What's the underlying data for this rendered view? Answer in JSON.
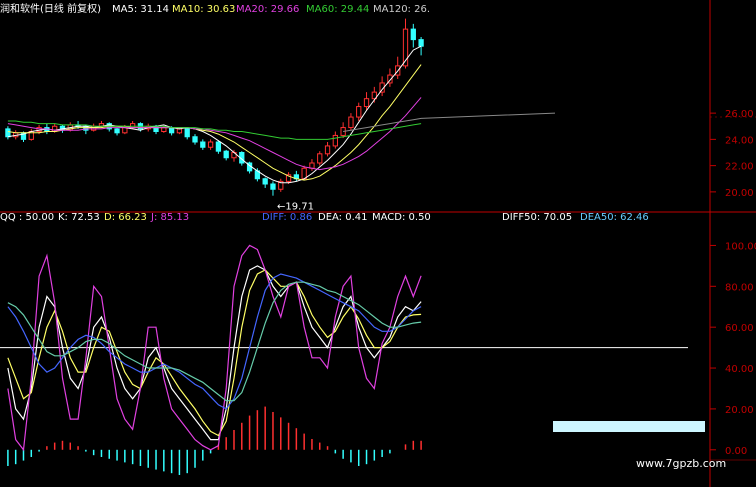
{
  "header": {
    "title": "润和软件(日线 前复权)",
    "ma5": "MA5: 31.14",
    "ma10": "MA10: 30.63",
    "ma20": "MA20: 29.66",
    "ma60": "MA60: 29.44",
    "ma120": "MA120: 26."
  },
  "indicator_header": {
    "qq": "QQ : 50.00",
    "k": "K: 72.53",
    "d": "D: 66.23",
    "j": "J: 85.13",
    "diff": "DIFF: 0.86",
    "dea": "DEA: 0.41",
    "macd": "MACD: 0.50",
    "diff50": "DIFF50: 70.05",
    "dea50": "DEA50: 62.46"
  },
  "annotations": {
    "low_marker": "←19.71",
    "watermark": "www.7gpzb.com"
  },
  "colors": {
    "up": "#ff3030",
    "down": "#33ffff",
    "ma5": "#ffffff",
    "ma10": "#ffff66",
    "ma20": "#e040e0",
    "ma60": "#33cc33",
    "ma120": "#888888",
    "k": "#ffffff",
    "d": "#ffff66",
    "j": "#e040e0",
    "axis": "#c00000"
  },
  "chart_data": [
    {
      "type": "candlestick",
      "title": "润和软件(日线 前复权)",
      "ylim": [
        19,
        27
      ],
      "y_ticks": [
        "26.00",
        "24.00",
        "22.00",
        "20.00"
      ],
      "low_label": "19.71",
      "series": [
        {
          "name": "MA5",
          "values": [
            24.2,
            24.3,
            24.4,
            24.6,
            24.7,
            24.8,
            24.7,
            24.8,
            24.9,
            25.0,
            25.0,
            24.9,
            25.0,
            25.1,
            25.0,
            24.9,
            24.8,
            24.7,
            24.9,
            25.0,
            25.1,
            24.9,
            24.8,
            24.9,
            24.8,
            24.6,
            24.3,
            23.9,
            23.5,
            23.0,
            22.5,
            22.0,
            21.6,
            21.2,
            20.9,
            20.7,
            20.7,
            20.8,
            21.0,
            21.4,
            21.9,
            22.4,
            23.0,
            23.6,
            24.4,
            25.3,
            26.2,
            27.0,
            27.8,
            28.5,
            29.2,
            30.0,
            30.8,
            31.1
          ]
        },
        {
          "name": "MA10",
          "values": [
            24.6,
            24.5,
            24.5,
            24.5,
            24.5,
            24.6,
            24.6,
            24.7,
            24.8,
            24.9,
            24.9,
            24.9,
            24.9,
            25.0,
            25.0,
            25.0,
            24.9,
            24.9,
            24.9,
            24.9,
            24.9,
            24.9,
            24.9,
            24.9,
            24.8,
            24.7,
            24.6,
            24.4,
            24.1,
            23.8,
            23.4,
            23.0,
            22.6,
            22.2,
            21.8,
            21.5,
            21.2,
            21.0,
            20.9,
            21.0,
            21.2,
            21.6,
            22.0,
            22.5,
            23.0,
            23.6,
            24.3,
            25.0,
            25.8,
            26.5,
            27.3,
            28.1,
            28.9,
            29.7
          ]
        },
        {
          "name": "MA20",
          "values": [
            25.2,
            25.1,
            25.0,
            24.9,
            24.8,
            24.8,
            24.7,
            24.7,
            24.7,
            24.7,
            24.8,
            24.8,
            24.8,
            24.9,
            24.9,
            24.9,
            24.9,
            24.9,
            24.9,
            24.9,
            24.9,
            24.9,
            24.9,
            24.9,
            24.8,
            24.8,
            24.7,
            24.6,
            24.5,
            24.3,
            24.1,
            23.9,
            23.6,
            23.3,
            23.0,
            22.7,
            22.4,
            22.1,
            21.9,
            21.8,
            21.7,
            21.8,
            21.9,
            22.1,
            22.4,
            22.7,
            23.1,
            23.6,
            24.1,
            24.6,
            25.2,
            25.8,
            26.5,
            27.2
          ]
        },
        {
          "name": "MA60",
          "values": [
            25.4,
            25.4,
            25.3,
            25.3,
            25.2,
            25.2,
            25.2,
            25.1,
            25.1,
            25.1,
            25.1,
            25.0,
            25.0,
            25.0,
            25.0,
            25.0,
            25.0,
            25.0,
            25.0,
            25.0,
            25.0,
            24.9,
            24.9,
            24.9,
            24.9,
            24.8,
            24.8,
            24.7,
            24.7,
            24.6,
            24.6,
            24.5,
            24.4,
            24.3,
            24.2,
            24.1,
            24.1,
            24.0,
            24.0,
            24.0,
            24.0,
            24.0,
            24.1,
            24.2,
            24.3,
            24.4,
            24.5,
            24.6,
            24.7,
            24.8,
            24.9,
            25.0,
            25.1,
            25.2
          ]
        },
        {
          "name": "MA120",
          "values": [
            null,
            null,
            null,
            null,
            null,
            null,
            null,
            null,
            null,
            null,
            null,
            null,
            null,
            null,
            null,
            null,
            null,
            null,
            null,
            null,
            null,
            null,
            null,
            null,
            null,
            null,
            null,
            null,
            null,
            null,
            null,
            null,
            null,
            null,
            null,
            null,
            null,
            null,
            null,
            null,
            null,
            null,
            null,
            24.6,
            24.7,
            24.8,
            24.9,
            25.0,
            25.1,
            25.2,
            25.3,
            25.4,
            25.5,
            25.6
          ]
        }
      ],
      "candles": [
        [
          24.8,
          24.2,
          25.0,
          24.0
        ],
        [
          24.2,
          24.5,
          24.7,
          24.0
        ],
        [
          24.5,
          24.0,
          24.6,
          23.8
        ],
        [
          24.0,
          24.6,
          24.8,
          23.9
        ],
        [
          24.6,
          24.9,
          25.1,
          24.4
        ],
        [
          24.9,
          24.6,
          25.2,
          24.4
        ],
        [
          24.6,
          25.0,
          25.2,
          24.5
        ],
        [
          25.0,
          24.7,
          25.1,
          24.5
        ],
        [
          24.7,
          25.1,
          25.3,
          24.6
        ],
        [
          25.1,
          25.0,
          25.4,
          24.8
        ],
        [
          25.0,
          24.7,
          25.1,
          24.4
        ],
        [
          24.7,
          25.0,
          25.2,
          24.6
        ],
        [
          25.0,
          25.2,
          25.4,
          24.9
        ],
        [
          25.2,
          24.8,
          25.3,
          24.6
        ],
        [
          24.8,
          24.5,
          24.9,
          24.3
        ],
        [
          24.5,
          24.9,
          25.1,
          24.4
        ],
        [
          24.9,
          25.2,
          25.4,
          24.8
        ],
        [
          25.2,
          24.8,
          25.3,
          24.6
        ],
        [
          24.8,
          25.0,
          25.2,
          24.6
        ],
        [
          25.0,
          24.6,
          25.1,
          24.4
        ],
        [
          24.6,
          24.9,
          25.0,
          24.5
        ],
        [
          24.9,
          24.5,
          25.0,
          24.3
        ],
        [
          24.5,
          24.8,
          24.9,
          24.4
        ],
        [
          24.8,
          24.2,
          24.9,
          24.0
        ],
        [
          24.2,
          23.8,
          24.4,
          23.6
        ],
        [
          23.8,
          23.4,
          24.0,
          23.2
        ],
        [
          23.4,
          23.8,
          24.0,
          23.2
        ],
        [
          23.8,
          23.1,
          23.9,
          22.9
        ],
        [
          23.1,
          22.6,
          23.2,
          22.4
        ],
        [
          22.6,
          23.0,
          23.2,
          22.3
        ],
        [
          23.0,
          22.2,
          23.1,
          22.0
        ],
        [
          22.2,
          21.6,
          22.3,
          21.4
        ],
        [
          21.6,
          21.0,
          21.8,
          20.8
        ],
        [
          21.0,
          20.6,
          21.1,
          20.3
        ],
        [
          20.6,
          20.2,
          20.8,
          19.71
        ],
        [
          20.2,
          20.8,
          21.0,
          20.0
        ],
        [
          20.8,
          21.3,
          21.5,
          20.6
        ],
        [
          21.3,
          21.0,
          21.6,
          20.8
        ],
        [
          21.0,
          21.8,
          22.0,
          20.9
        ],
        [
          21.8,
          22.2,
          22.5,
          21.6
        ],
        [
          22.2,
          22.9,
          23.1,
          22.0
        ],
        [
          22.9,
          23.5,
          23.8,
          22.7
        ],
        [
          23.5,
          24.3,
          24.6,
          23.3
        ],
        [
          24.3,
          24.9,
          25.3,
          24.1
        ],
        [
          24.9,
          25.7,
          26.0,
          24.7
        ],
        [
          25.7,
          26.5,
          26.8,
          25.4
        ],
        [
          26.5,
          27.1,
          27.6,
          26.2
        ],
        [
          27.1,
          27.6,
          28.0,
          26.8
        ],
        [
          27.6,
          28.3,
          28.8,
          27.3
        ],
        [
          28.3,
          28.9,
          29.4,
          28.0
        ],
        [
          28.9,
          29.6,
          30.3,
          28.6
        ],
        [
          29.6,
          32.4,
          33.2,
          29.4
        ],
        [
          32.4,
          31.6,
          32.8,
          31.0
        ],
        [
          31.6,
          31.1,
          31.8,
          30.4
        ]
      ]
    },
    {
      "type": "line",
      "title": "",
      "ylim": [
        -5,
        110
      ],
      "y_ticks": [
        "100.00",
        "80.00",
        "60.00",
        "40.00",
        "20.00",
        "0.00"
      ],
      "qq_level": 50,
      "series": [
        {
          "name": "K",
          "values": [
            40,
            20,
            15,
            30,
            60,
            75,
            70,
            50,
            35,
            30,
            40,
            60,
            65,
            55,
            40,
            30,
            25,
            30,
            45,
            50,
            40,
            30,
            25,
            20,
            15,
            10,
            5,
            5,
            20,
            50,
            75,
            88,
            90,
            88,
            80,
            75,
            80,
            82,
            70,
            60,
            55,
            50,
            60,
            70,
            75,
            60,
            50,
            45,
            50,
            55,
            65,
            70,
            68,
            72.53
          ]
        },
        {
          "name": "D",
          "values": [
            45,
            35,
            25,
            28,
            45,
            60,
            68,
            58,
            45,
            38,
            38,
            50,
            60,
            58,
            48,
            38,
            32,
            30,
            38,
            45,
            42,
            36,
            30,
            25,
            20,
            14,
            9,
            7,
            14,
            35,
            60,
            78,
            86,
            88,
            84,
            80,
            80,
            82,
            75,
            66,
            60,
            55,
            58,
            65,
            70,
            64,
            56,
            50,
            50,
            53,
            60,
            65,
            66,
            66.23
          ]
        },
        {
          "name": "J",
          "values": [
            30,
            5,
            0,
            35,
            85,
            95,
            72,
            35,
            15,
            15,
            45,
            80,
            75,
            50,
            25,
            15,
            10,
            30,
            60,
            60,
            35,
            20,
            15,
            10,
            5,
            2,
            0,
            2,
            30,
            80,
            95,
            100,
            98,
            88,
            75,
            65,
            80,
            82,
            60,
            45,
            45,
            40,
            65,
            80,
            85,
            50,
            35,
            30,
            52,
            60,
            75,
            85,
            75,
            85.13
          ]
        },
        {
          "name": "DIFF50",
          "values": [
            70,
            65,
            58,
            50,
            42,
            38,
            40,
            45,
            50,
            54,
            56,
            55,
            52,
            48,
            45,
            42,
            40,
            38,
            38,
            40,
            42,
            40,
            38,
            35,
            32,
            30,
            26,
            22,
            20,
            25,
            35,
            50,
            65,
            78,
            84,
            86,
            85,
            84,
            82,
            80,
            78,
            76,
            74,
            72,
            70,
            68,
            64,
            60,
            58,
            58,
            60,
            64,
            68,
            70.05
          ]
        },
        {
          "name": "DEA50",
          "values": [
            72,
            70,
            66,
            60,
            54,
            48,
            46,
            46,
            48,
            50,
            53,
            54,
            54,
            52,
            49,
            46,
            44,
            42,
            40,
            40,
            40,
            40,
            39,
            37,
            35,
            33,
            30,
            27,
            24,
            24,
            28,
            38,
            50,
            62,
            72,
            78,
            81,
            82,
            82,
            81,
            80,
            78,
            77,
            75,
            73,
            71,
            68,
            65,
            62,
            60,
            60,
            61,
            62,
            62.46
          ]
        }
      ],
      "macd": [
        -18,
        -16,
        -12,
        -8,
        -2,
        4,
        8,
        10,
        8,
        4,
        -2,
        -6,
        -8,
        -10,
        -12,
        -14,
        -16,
        -18,
        -20,
        -22,
        -24,
        -26,
        -28,
        -26,
        -20,
        -12,
        -4,
        6,
        14,
        22,
        30,
        38,
        44,
        48,
        42,
        36,
        30,
        24,
        18,
        12,
        8,
        4,
        -4,
        -10,
        -14,
        -18,
        -16,
        -12,
        -8,
        -4,
        0,
        6,
        10,
        10
      ]
    }
  ]
}
